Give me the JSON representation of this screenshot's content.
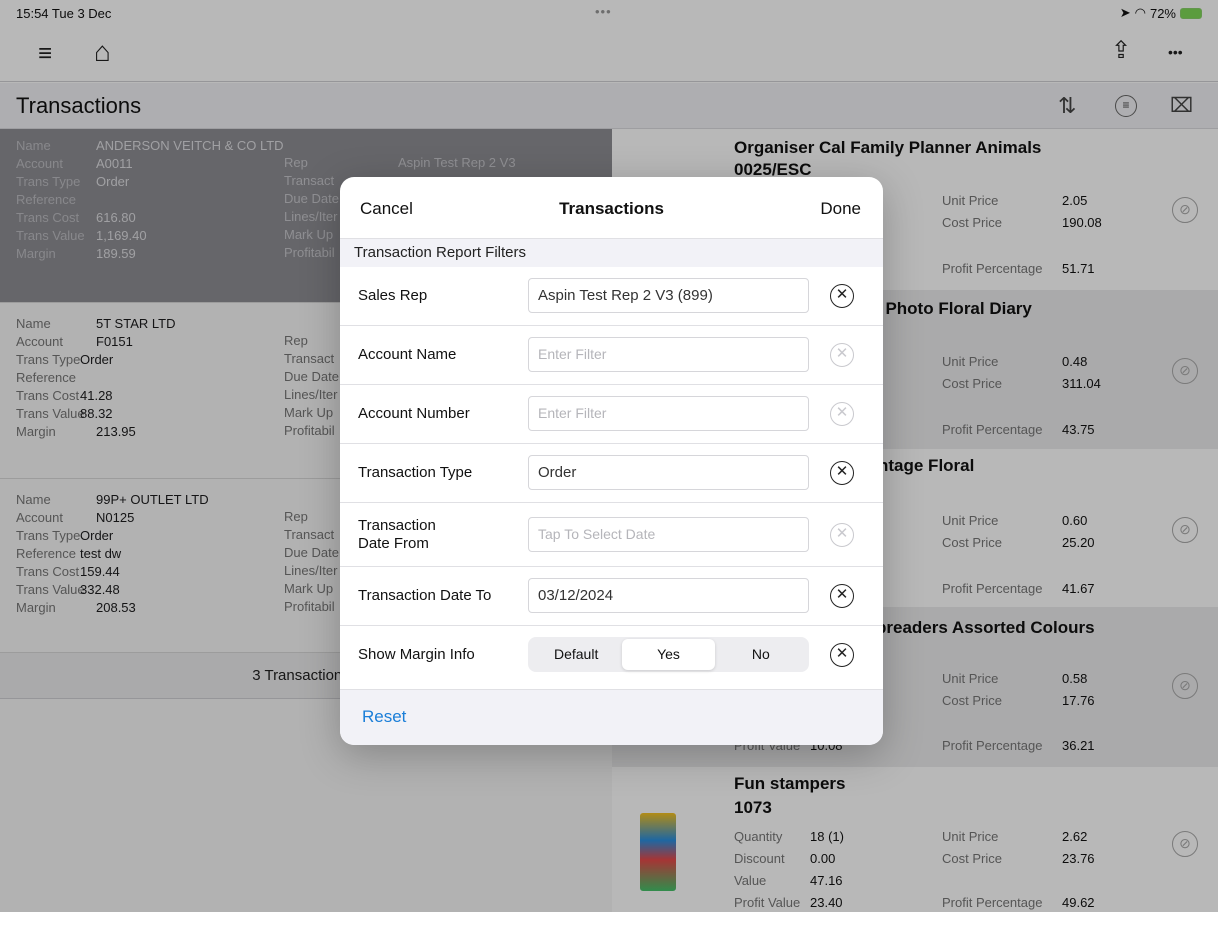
{
  "status_bar": {
    "time": "15:54  Tue 3 Dec",
    "dots": "•••",
    "battery": "72%"
  },
  "toolbar": {
    "menu_icon": "≡",
    "home_icon": "⌂",
    "share_icon": "⇪",
    "more_icon": "•••"
  },
  "header": {
    "title": "Transactions"
  },
  "transactions": [
    {
      "name_label": "Name",
      "name": "ANDERSON VEITCH & CO LTD",
      "account_label": "Account",
      "account": "A0011",
      "trans_type_label": "Trans Type",
      "trans_type": "Order",
      "reference_label": "Reference",
      "reference": "",
      "trans_cost_label": "Trans Cost",
      "trans_cost": "616.80",
      "trans_value_label": "Trans Value",
      "trans_value": "1,169.40",
      "margin_label": "Margin",
      "margin": "189.59",
      "rep_label": "Rep",
      "rep": "Aspin Test Rep 2 V3",
      "transact_label": "Transact",
      "due_label": "Due Date",
      "lines_label": "Lines/Iter",
      "markup_label": "Mark Up",
      "profit_label": "Profitabil"
    },
    {
      "name_label": "Name",
      "name": "5T STAR LTD",
      "account_label": "Account",
      "account": "F0151",
      "trans_type_label": "Trans Type",
      "trans_type": "Order",
      "reference_label": "Reference",
      "reference": "",
      "trans_cost_label": "Trans Cost",
      "trans_cost": "41.28",
      "trans_value_label": "Trans Value",
      "trans_value": "88.32",
      "margin_label": "Margin",
      "margin": "213.95",
      "rep_label": "Rep",
      "transact_label": "Transact",
      "due_label": "Due Date",
      "lines_label": "Lines/Iter",
      "markup_label": "Mark Up",
      "profit_label": "Profitabil"
    },
    {
      "name_label": "Name",
      "name": "99P+ OUTLET LTD",
      "account_label": "Account",
      "account": "N0125",
      "trans_type_label": "Trans Type",
      "trans_type": "Order",
      "reference_label": "Reference",
      "reference": "test dw",
      "trans_cost_label": "Trans Cost",
      "trans_cost": "159.44",
      "trans_value_label": "Trans Value",
      "trans_value": "332.48",
      "margin_label": "Margin",
      "margin": "208.53",
      "rep_label": "Rep",
      "transact_label": "Transact",
      "due_label": "Due Date",
      "lines_label": "Lines/Iter",
      "markup_label": "Mark Up",
      "profit_label": "Profitabil"
    }
  ],
  "transaction_count": "3 Transaction(s)",
  "products": [
    {
      "title": "Organiser Cal Family Planner Animals",
      "title2": "0025/ESC",
      "unit_price_label": "Unit Price",
      "unit_price": "2.05",
      "cost_price_label": "Cost Price",
      "cost_price": "190.08",
      "profit_pct_label": "Profit Percentage",
      "profit_pct": "51.71"
    },
    {
      "title": "/ Photo Floral Diary",
      "unit_price_label": "Unit Price",
      "unit_price": "0.48",
      "cost_price_label": "Cost Price",
      "cost_price": "311.04",
      "profit_pct_label": "Profit Percentage",
      "profit_pct": "43.75"
    },
    {
      "title": "ntage Floral",
      "unit_price_label": "Unit Price",
      "unit_price": "0.60",
      "cost_price_label": "Cost Price",
      "cost_price": "25.20",
      "profit_pct_label": "Profit Percentage",
      "profit_pct": "41.67"
    },
    {
      "title": "preaders Assorted Colours",
      "unit_price_label": "Unit Price",
      "unit_price": "0.58",
      "cost_price_label": "Cost Price",
      "cost_price": "17.76",
      "profit_value_label": "Profit Value",
      "profit_value": "10.08",
      "profit_pct_label": "Profit Percentage",
      "profit_pct": "36.21"
    },
    {
      "title": "Fun stampers",
      "title2": "1073",
      "quantity_label": "Quantity",
      "quantity": "18 (1)",
      "discount_label": "Discount",
      "discount": "0.00",
      "value_label": "Value",
      "value": "47.16",
      "profit_value_label": "Profit Value",
      "profit_value": "23.40",
      "unit_price_label": "Unit Price",
      "unit_price": "2.62",
      "cost_price_label": "Cost Price",
      "cost_price": "23.76",
      "profit_pct_label": "Profit Percentage",
      "profit_pct": "49.62"
    }
  ],
  "modal": {
    "cancel": "Cancel",
    "title": "Transactions",
    "done": "Done",
    "section": "Transaction Report Filters",
    "sales_rep": {
      "label": "Sales Rep",
      "value": "Aspin Test Rep 2 V3 (899)"
    },
    "account_name": {
      "label": "Account Name",
      "placeholder": "Enter Filter"
    },
    "account_number": {
      "label": "Account Number",
      "placeholder": "Enter Filter"
    },
    "transaction_type": {
      "label": "Transaction Type",
      "value": "Order"
    },
    "date_from": {
      "label_line1": "Transaction",
      "label_line2": "Date From",
      "placeholder": "Tap To Select Date"
    },
    "date_to": {
      "label": "Transaction Date To",
      "value": "03/12/2024"
    },
    "margin": {
      "label": "Show Margin Info",
      "options": [
        "Default",
        "Yes",
        "No"
      ],
      "selected": "Yes"
    },
    "clear_icon": "✕",
    "reset": "Reset"
  }
}
